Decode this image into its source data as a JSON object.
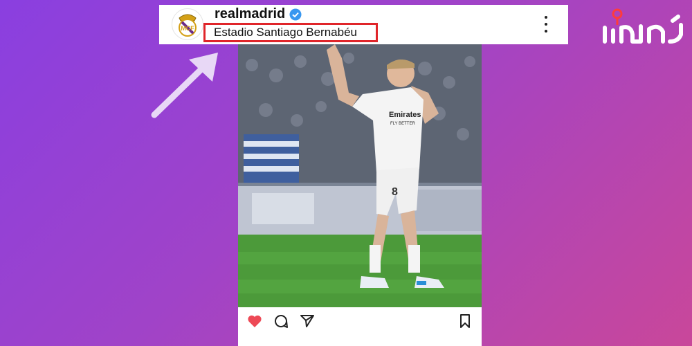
{
  "post": {
    "username": "realmadrid",
    "location": "Estadio Santiago Bernabéu",
    "icons": {
      "avatar": "real-madrid-crest-icon",
      "verified": "verified-badge-icon",
      "more": "more-options-icon",
      "like": "heart-icon",
      "comment": "comment-icon",
      "share": "send-icon",
      "save": "bookmark-icon"
    },
    "player_number": "8",
    "sponsor": "Emirates",
    "sponsor_tagline": "FLY BETTER"
  },
  "colors": {
    "highlight": "#e0252a",
    "heart": "#ed4956",
    "verified": "#3897f0",
    "arrow": "#e8d8f6"
  }
}
